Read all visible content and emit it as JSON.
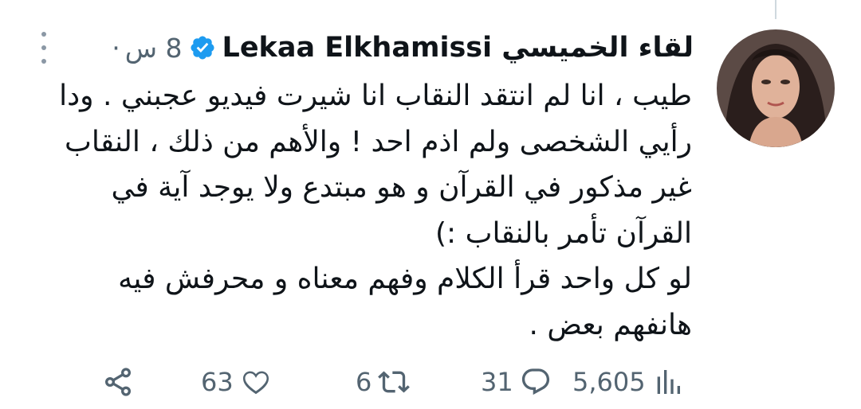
{
  "tweet": {
    "display_name": "Lekaa Elkhamissi لقاء الخميسي",
    "time_ago": "8 س",
    "separator": "·",
    "text_lines": [
      "طيب ، انا لم انتقد النقاب انا شيرت فيديو عجبني . ودا",
      "رأيي الشخصى ولم اذم احد ! والأهم من ذلك ، النقاب",
      "غير مذكور في القرآن و هو مبتدع ولا يوجد آية في",
      "القرآن تأمر بالنقاب :)",
      "لو كل واحد قرأ الكلام وفهم معناه و محرفش فيه",
      "هانفهم بعض ."
    ]
  },
  "actions": {
    "views": "5,605",
    "replies": "31",
    "retweets": "6",
    "likes": "63"
  },
  "colors": {
    "verified": "#1d9bf0",
    "text": "#0f1419",
    "muted": "#536471"
  },
  "icons": {
    "more": "more-vertical-icon",
    "verified": "verified-badge-icon",
    "views": "views-bar-chart-icon",
    "reply": "reply-bubble-icon",
    "retweet": "retweet-icon",
    "like": "heart-icon",
    "share": "share-icon"
  }
}
